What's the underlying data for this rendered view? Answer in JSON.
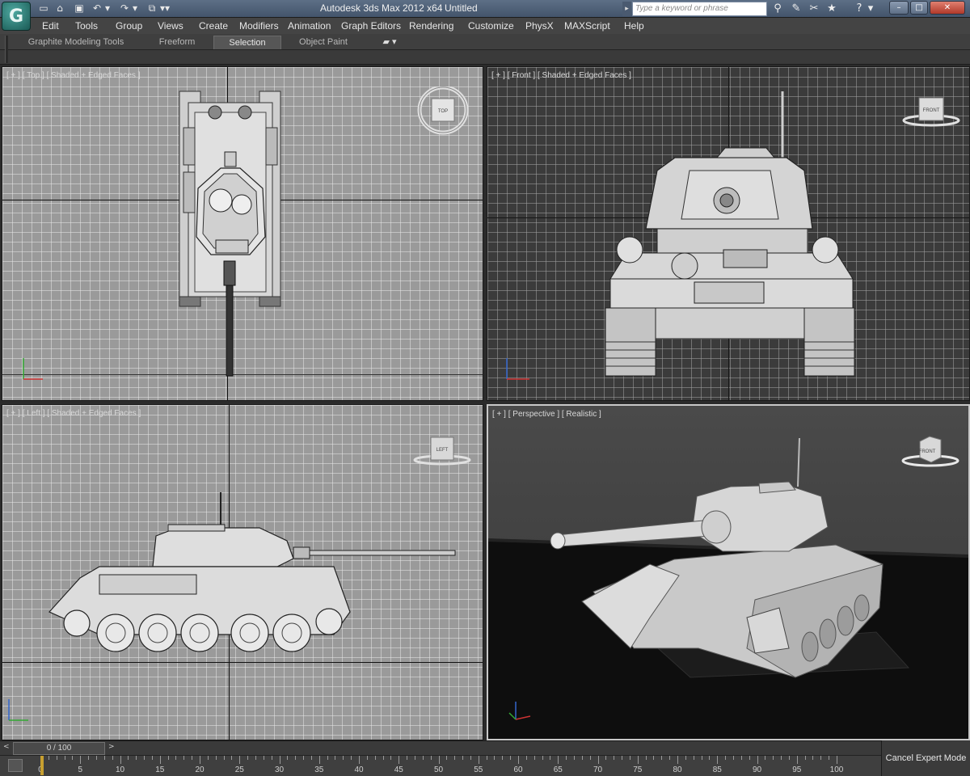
{
  "window": {
    "title": "Autodesk 3ds Max  2012 x64",
    "file_name": "Untitled",
    "search_placeholder": "Type a keyword or phrase",
    "logo_glyph": "G"
  },
  "quick_access": [
    "new-icon",
    "open-icon",
    "save-icon",
    "undo-icon",
    "redo-icon",
    "project-icon",
    "customize-icon"
  ],
  "menu": [
    "Edit",
    "Tools",
    "Group",
    "Views",
    "Create",
    "Modifiers",
    "Animation",
    "Graph Editors",
    "Rendering",
    "Customize",
    "PhysX",
    "MAXScript",
    "Help"
  ],
  "ribbon": {
    "tabs": [
      "Graphite Modeling Tools",
      "Freeform",
      "Selection",
      "Object Paint"
    ],
    "active_tab": "Selection"
  },
  "viewports": {
    "top": {
      "label": "[ + ] [ Top ] [ Shaded + Edged Faces ]",
      "cube": "TOP"
    },
    "front": {
      "label": "[ + ] [ Front ] [ Shaded + Edged Faces ]",
      "cube": "FRONT"
    },
    "left": {
      "label": "[ + ] [ Left ] [ Shaded + Edged Faces ]",
      "cube": "LEFT"
    },
    "perspective": {
      "label": "[ + ] [ Perspective ] [ Realistic ]",
      "cube": "FRONT"
    }
  },
  "timeline": {
    "frame_display": "0 / 100",
    "ticks": [
      0,
      5,
      10,
      15,
      20,
      25,
      30,
      35,
      40,
      45,
      50,
      55,
      60,
      65,
      70,
      75,
      80,
      85,
      90,
      95,
      100
    ]
  },
  "status": {
    "cancel_expert": "Cancel Expert Mode"
  },
  "colors": {
    "title_bar": "#4f6079",
    "active_viewport_border": "#c8c8c8",
    "ortho_grid": "#9a9a9a"
  }
}
